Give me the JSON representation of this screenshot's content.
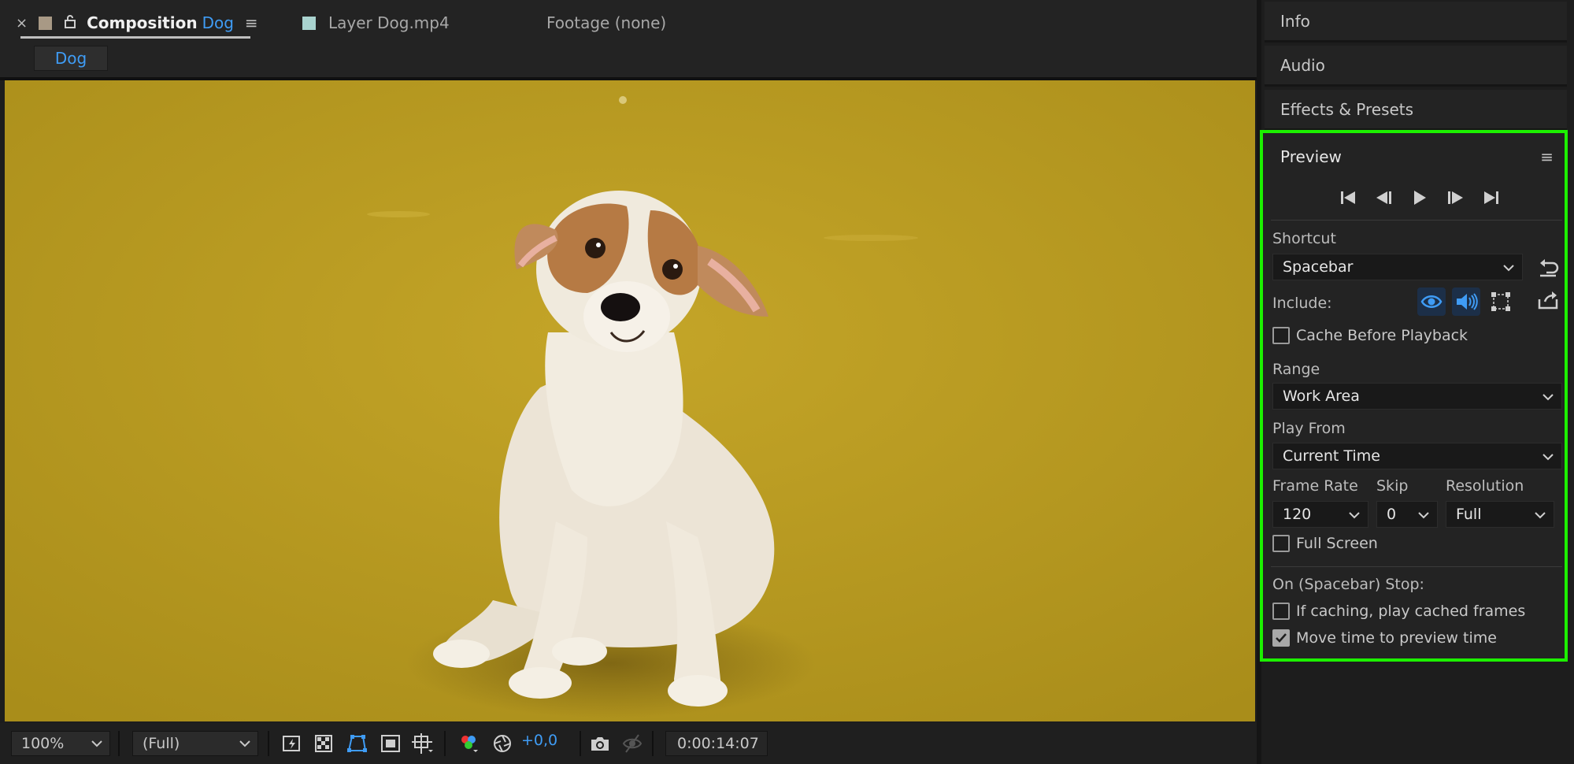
{
  "composition_tab": {
    "close": "×",
    "title": "Composition",
    "name": "Dog",
    "menu": "≡",
    "swatch_color": "#a89985"
  },
  "layer_tab": {
    "label": "Layer Dog.mp4",
    "swatch_color": "#a9d3cf"
  },
  "footage_tab": {
    "label": "Footage (none)"
  },
  "breadcrumb": {
    "label": "Dog"
  },
  "viewer_toolbar": {
    "zoom": "100%",
    "resolution": "(Full)",
    "exposure": "+0,0",
    "timecode": "0:00:14:07"
  },
  "right_panels": {
    "info": "Info",
    "audio": "Audio",
    "effects": "Effects & Presets"
  },
  "preview": {
    "title": "Preview",
    "menu": "≡",
    "shortcut_label": "Shortcut",
    "shortcut_value": "Spacebar",
    "include_label": "Include:",
    "cache_before_playback": "Cache Before Playback",
    "range_label": "Range",
    "range_value": "Work Area",
    "play_from_label": "Play From",
    "play_from_value": "Current Time",
    "frame_rate_label": "Frame Rate",
    "frame_rate_value": "120",
    "skip_label": "Skip",
    "skip_value": "0",
    "resolution_label": "Resolution",
    "resolution_value": "Full",
    "full_screen": "Full Screen",
    "stop_label": "On (Spacebar) Stop:",
    "if_caching": "If caching, play cached frames",
    "move_time": "Move time to preview time",
    "move_time_checked": true
  },
  "colors": {
    "accent_blue": "#3f9cf5",
    "highlight_green": "#1cf000",
    "floor_yellow": "#b8991f"
  }
}
